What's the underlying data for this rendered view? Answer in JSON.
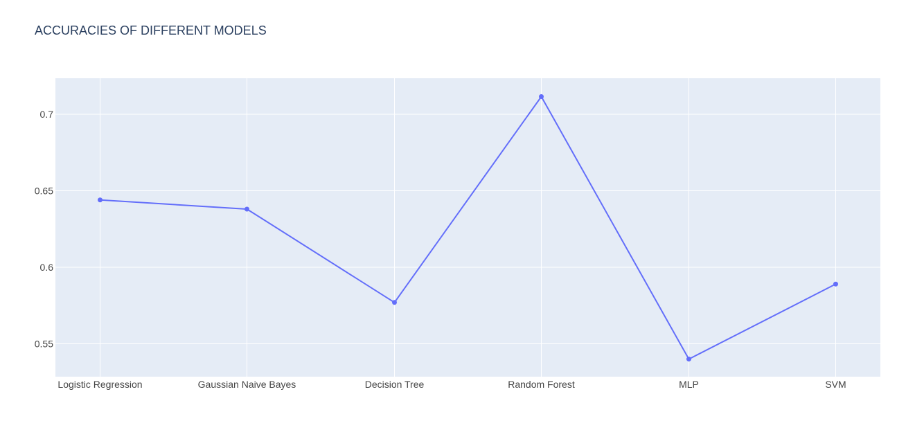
{
  "chart_data": {
    "type": "line",
    "title": "ACCURACIES OF DIFFERENT MODELS",
    "xlabel": "",
    "ylabel": "",
    "categories": [
      "Logistic Regression",
      "Gaussian Naive Bayes",
      "Decision Tree",
      "Random Forest",
      "MLP",
      "SVM"
    ],
    "series": [
      {
        "values": [
          0.644,
          0.638,
          0.577,
          0.7115,
          0.54,
          0.589
        ]
      }
    ],
    "ylim": [
      0.5285,
      0.7235
    ],
    "yticks": [
      0.55,
      0.6,
      0.65,
      0.7
    ],
    "ytick_labels": [
      "0.55",
      "0.6",
      "0.65",
      "0.7"
    ],
    "grid": true,
    "markers": true,
    "colors": {
      "line": "#636efa",
      "plot_bg": "#e5ecf6",
      "paper_bg": "#ffffff",
      "grid": "#ffffff",
      "title": "#2a3f5f",
      "tick": "#444444"
    }
  }
}
